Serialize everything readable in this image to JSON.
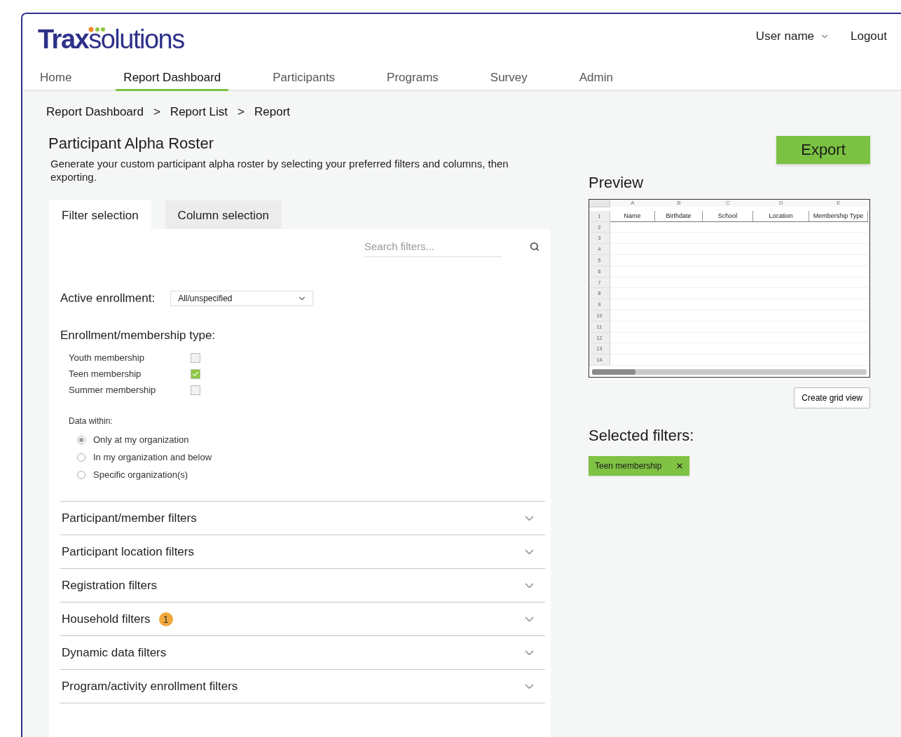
{
  "logo": {
    "brand_bold": "Trax",
    "brand_light": "solutions"
  },
  "user_menu": {
    "user_name": "User name",
    "logout": "Logout"
  },
  "nav": [
    {
      "label": "Home",
      "selected": false
    },
    {
      "label": "Report Dashboard",
      "selected": true
    },
    {
      "label": "Participants",
      "selected": false
    },
    {
      "label": "Programs",
      "selected": false
    },
    {
      "label": "Survey",
      "selected": false
    },
    {
      "label": "Admin",
      "selected": false
    }
  ],
  "breadcrumb": {
    "items": [
      "Report Dashboard",
      "Report List",
      "Report"
    ],
    "separator": ">"
  },
  "title": "Participant Alpha Roster",
  "description": "Generate your custom participant alpha roster by selecting your preferred filters and columns, then exporting.",
  "tabs": [
    {
      "label": "Filter selection",
      "selected": true
    },
    {
      "label": "Column selection",
      "selected": false
    }
  ],
  "search": {
    "placeholder": "Search filters..."
  },
  "active_enrollment": {
    "label": "Active enrollment:",
    "value": "All/unspecified"
  },
  "membership": {
    "label": "Enrollment/membership type:",
    "options": [
      {
        "label": "Youth membership",
        "checked": false
      },
      {
        "label": "Teen membership",
        "checked": true
      },
      {
        "label": "Summer membership",
        "checked": false
      }
    ]
  },
  "data_within": {
    "label": "Data within:",
    "options": [
      {
        "label": "Only at my organization",
        "selected": true
      },
      {
        "label": "In my organization and below",
        "selected": false
      },
      {
        "label": "Specific organization(s)",
        "selected": false
      }
    ]
  },
  "filter_sections": [
    {
      "label": "Participant/member filters",
      "expanded": false
    },
    {
      "label": "Participant location filters",
      "expanded": false
    },
    {
      "label": "Registration filters",
      "expanded": false
    },
    {
      "label": "Household filters",
      "expanded": false,
      "badge": "1"
    },
    {
      "label": "Dynamic data filters",
      "expanded": false
    },
    {
      "label": "Program/activity enrollment filters",
      "expanded": false
    }
  ],
  "export_button": "Export",
  "preview": {
    "title": "Preview",
    "column_letters": [
      "A",
      "B",
      "C",
      "D",
      "E"
    ],
    "headers": [
      "Name",
      "Birthdate",
      "School",
      "Location",
      "Membership Type"
    ],
    "row_numbers": [
      "1",
      "2",
      "3",
      "4",
      "5",
      "6",
      "7",
      "8",
      "9",
      "10",
      "11",
      "12",
      "13",
      "14"
    ]
  },
  "create_grid_button": "Create grid view",
  "selected_filters": {
    "title": "Selected filters:",
    "chips": [
      {
        "label": "Teen membership"
      }
    ]
  }
}
